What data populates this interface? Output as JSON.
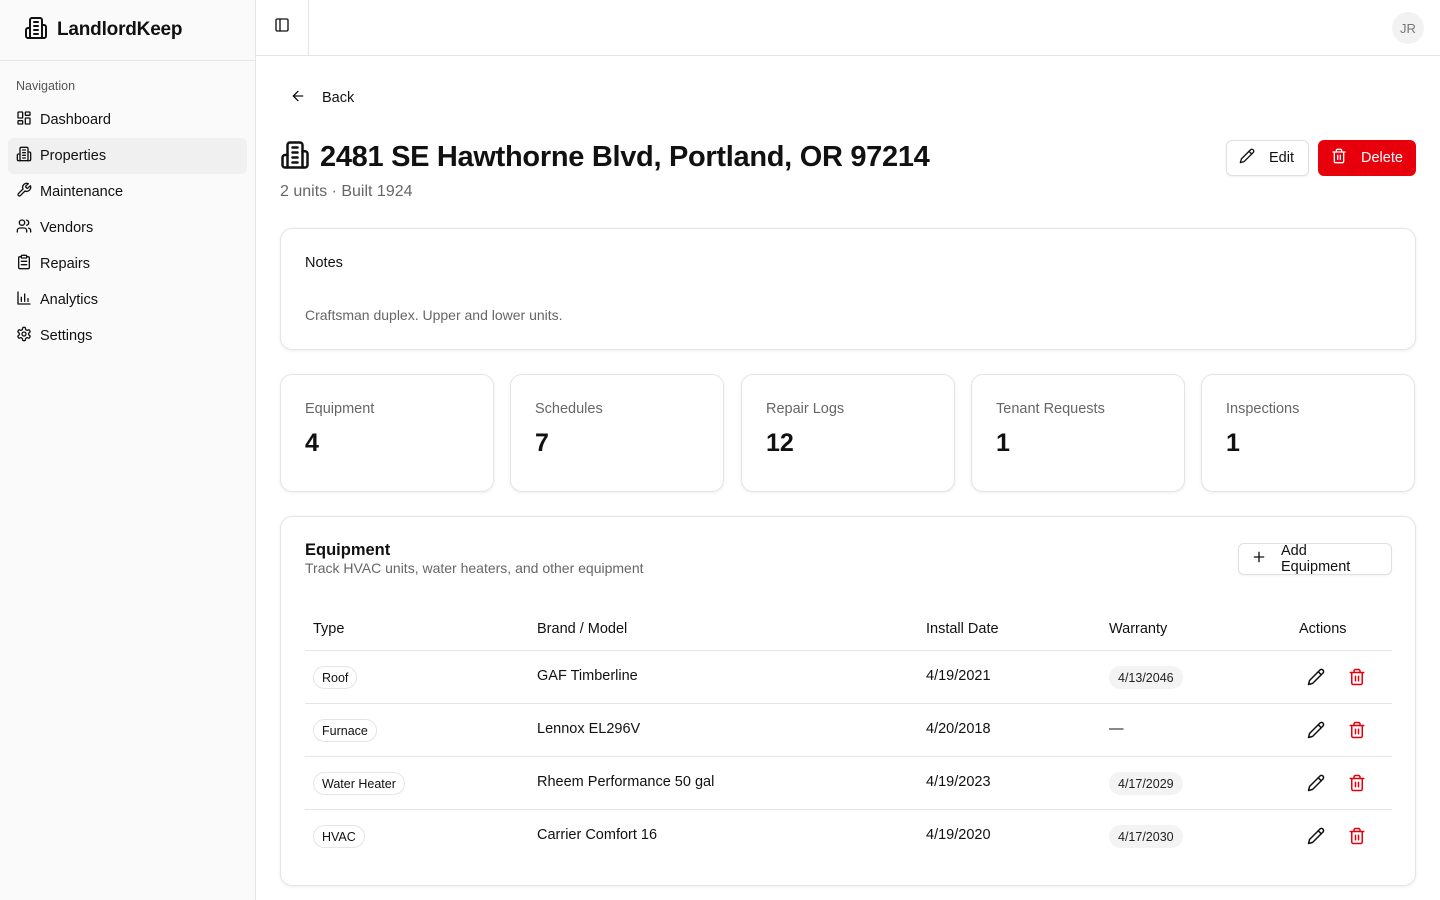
{
  "app": {
    "name": "LandlordKeep",
    "user_initials": "JR"
  },
  "sidebar": {
    "heading": "Navigation",
    "items": [
      {
        "label": "Dashboard",
        "icon": "dashboard-icon"
      },
      {
        "label": "Properties",
        "icon": "building-icon",
        "active": true
      },
      {
        "label": "Maintenance",
        "icon": "wrench-icon"
      },
      {
        "label": "Vendors",
        "icon": "users-icon"
      },
      {
        "label": "Repairs",
        "icon": "clipboard-icon"
      },
      {
        "label": "Analytics",
        "icon": "bar-chart-icon"
      },
      {
        "label": "Settings",
        "icon": "gear-icon"
      }
    ]
  },
  "page": {
    "back_label": "Back",
    "title": "2481 SE Hawthorne Blvd, Portland, OR 97214",
    "subtitle": "2 units · Built 1924",
    "edit_label": "Edit",
    "delete_label": "Delete",
    "accent_color": "#e7000b"
  },
  "notes": {
    "title": "Notes",
    "text": "Craftsman duplex. Upper and lower units."
  },
  "stats": [
    {
      "label": "Equipment",
      "value": "4"
    },
    {
      "label": "Schedules",
      "value": "7"
    },
    {
      "label": "Repair Logs",
      "value": "12"
    },
    {
      "label": "Tenant Requests",
      "value": "1"
    },
    {
      "label": "Inspections",
      "value": "1"
    }
  ],
  "equipment": {
    "title": "Equipment",
    "description": "Track HVAC units, water heaters, and other equipment",
    "add_label": "Add Equipment",
    "columns": [
      "Type",
      "Brand / Model",
      "Install Date",
      "Warranty",
      "Actions"
    ],
    "rows": [
      {
        "type": "Roof",
        "brand": "GAF Timberline",
        "install": "4/19/2021",
        "warranty": "4/13/2046"
      },
      {
        "type": "Furnace",
        "brand": "Lennox EL296V",
        "install": "4/20/2018",
        "warranty": "—"
      },
      {
        "type": "Water Heater",
        "brand": "Rheem Performance 50 gal",
        "install": "4/19/2023",
        "warranty": "4/17/2029"
      },
      {
        "type": "HVAC",
        "brand": "Carrier Comfort 16",
        "install": "4/19/2020",
        "warranty": "4/17/2030"
      }
    ]
  }
}
